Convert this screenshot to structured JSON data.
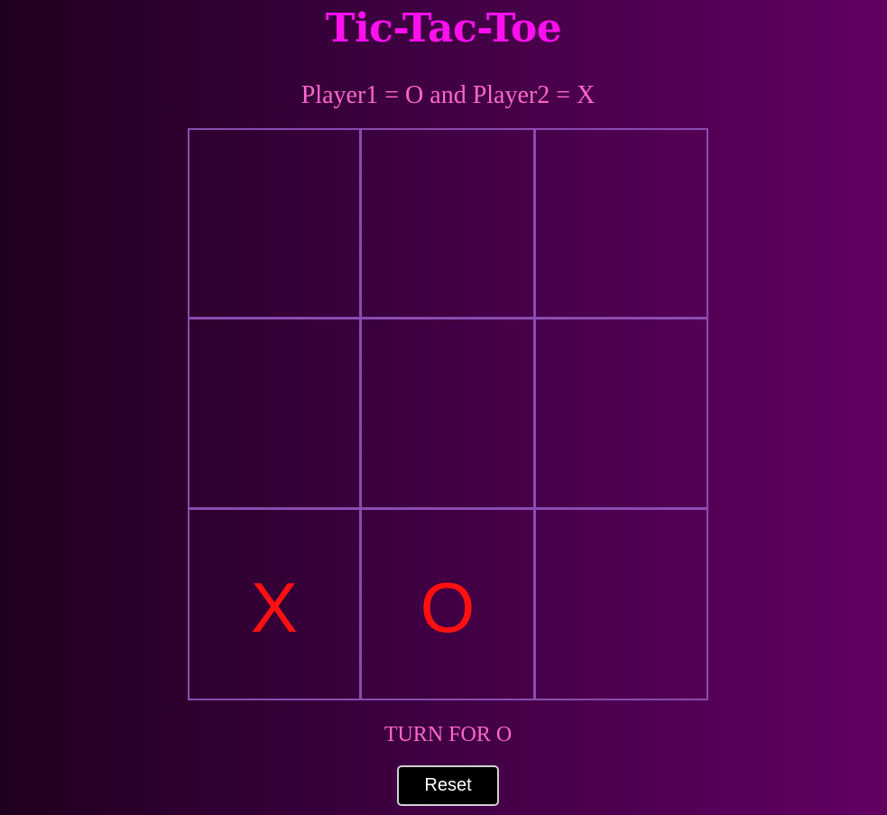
{
  "title": "Tic-Tac-Toe",
  "subtitle": "Player1 = O and Player2 = X",
  "board": {
    "cells": [
      "",
      "",
      "",
      "",
      "",
      "",
      "X",
      "O",
      ""
    ]
  },
  "status": "TURN FOR O",
  "reset_label": "Reset",
  "colors": {
    "title": "#ff10ee",
    "subtitle": "#ff66cc",
    "mark": "#ff1111",
    "grid_line": "#8a4cb0",
    "bg_left": "#20001f",
    "bg_right": "#620062"
  }
}
